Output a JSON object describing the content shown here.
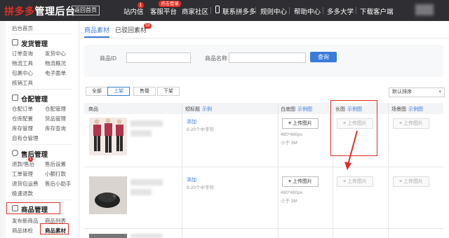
{
  "header": {
    "logo_brand": "拼多多",
    "logo_suffix": "管理后台",
    "return_home": "返回首页",
    "nav": [
      {
        "label": "站内信",
        "badge": "1"
      },
      {
        "label": "客服平台",
        "badge": "点击登录"
      },
      {
        "label": "商家社区"
      },
      {
        "label": "联系拼多多"
      },
      {
        "label": "规则中心"
      },
      {
        "label": "帮助中心"
      },
      {
        "label": "多多大学"
      },
      {
        "label": "下载客户端"
      }
    ]
  },
  "sidebar": {
    "home": "后台首页",
    "shipping": {
      "title": "发货管理",
      "items": [
        "订单查询",
        "发货中心",
        "物流工具",
        "物流概况",
        "包裹中心",
        "电子面单",
        "核销工具"
      ]
    },
    "warehouse": {
      "title": "仓配管理",
      "items": [
        "仓配订单",
        "仓配管理",
        "仓库配置",
        "货品管理",
        "库存管理",
        "库存查询",
        "自有仓管理"
      ]
    },
    "aftersale": {
      "title": "售后管理",
      "items": [
        "退款/售后",
        "售后设置",
        "工单管理",
        "小额打款",
        "退货包运费",
        "售后小助手",
        "极速退款"
      ],
      "badge": "1"
    },
    "goods": {
      "title": "商品管理",
      "items": [
        "发布新商品",
        "商品列表",
        "商品体检",
        "商品素材"
      ]
    }
  },
  "main": {
    "tabs": [
      {
        "label": "商品素材"
      },
      {
        "label": "已驳回素材",
        "badge": "58"
      }
    ],
    "filter": {
      "id_label": "商品ID",
      "name_label": "商品名称",
      "query_button": "查询"
    },
    "status_tabs": [
      "全部",
      "上架",
      "售罄",
      "下架"
    ],
    "sort": "默认排序",
    "table": {
      "columns": [
        {
          "label": "商品"
        },
        {
          "label": "短标题",
          "link": "示例"
        },
        {
          "label": "白底图",
          "link": "示例图"
        },
        {
          "label": "长图",
          "link": "示例图"
        },
        {
          "label": "场景图",
          "link": "示例图"
        }
      ],
      "add_link": "添加",
      "title_hint": "8-20个中字符",
      "image_hint_size": "480*480px",
      "image_hint_limit": "小于 3M",
      "upload_label": "上传图片",
      "upload_plus": "+"
    }
  },
  "colors": {
    "brand_red": "#e02e24",
    "accent_blue": "#3b7bd8",
    "topbar": "#2f2f33"
  }
}
